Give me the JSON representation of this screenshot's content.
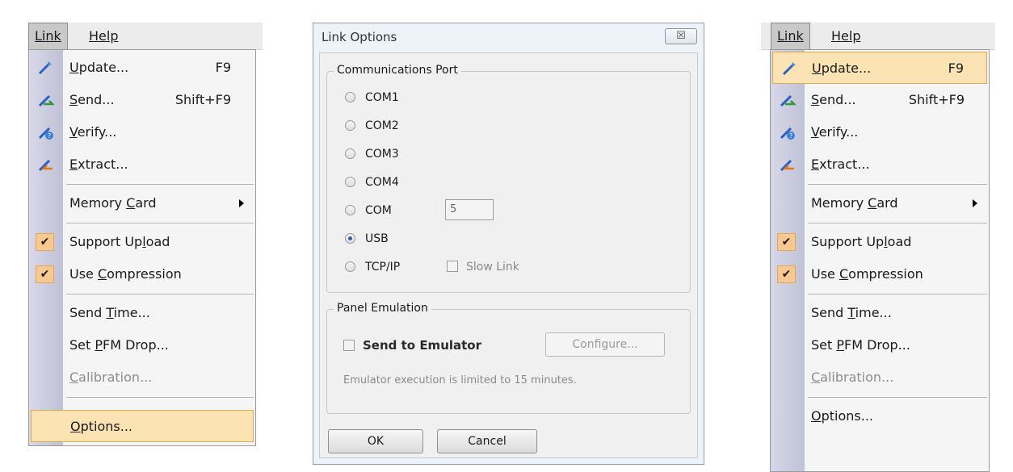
{
  "left_menu": {
    "menubar": {
      "link": "Link",
      "help": "Help"
    },
    "items": [
      {
        "label": "Update...",
        "shortcut": "F9",
        "icon": "wand-update-icon"
      },
      {
        "label": "Send...",
        "shortcut": "Shift+F9",
        "icon": "wand-send-icon"
      },
      {
        "label": "Verify...",
        "icon": "wand-verify-icon"
      },
      {
        "label": "Extract...",
        "icon": "wand-extract-icon"
      },
      {
        "label": "Memory Card"
      },
      {
        "label": "Support Upload",
        "checked": true
      },
      {
        "label": "Use Compression",
        "checked": true
      },
      {
        "label": "Send Time..."
      },
      {
        "label": "Set PFM Drop..."
      },
      {
        "label": "Calibration...",
        "disabled": true
      },
      {
        "label": "Options...",
        "highlighted": true
      }
    ]
  },
  "dialog": {
    "title": "Link Options",
    "close_glyph": "☒",
    "comm_port": {
      "legend": "Communications Port",
      "options": [
        "COM1",
        "COM2",
        "COM3",
        "COM4",
        "COM",
        "USB",
        "TCP/IP"
      ],
      "selected": "USB",
      "com_value": "5",
      "slow_link": "Slow Link"
    },
    "panel_emulation": {
      "legend": "Panel Emulation",
      "send_to_emulator": "Send to Emulator",
      "configure": "Configure...",
      "note": "Emulator execution is limited to 15 minutes."
    },
    "ok": "OK",
    "cancel": "Cancel"
  },
  "right_menu": {
    "menubar": {
      "link": "Link",
      "help": "Help"
    },
    "items": [
      {
        "label": "Update...",
        "shortcut": "F9",
        "highlighted": true
      },
      {
        "label": "Send...",
        "shortcut": "Shift+F9"
      },
      {
        "label": "Verify..."
      },
      {
        "label": "Extract..."
      },
      {
        "label": "Memory Card"
      },
      {
        "label": "Support Upload",
        "checked": true
      },
      {
        "label": "Use Compression",
        "checked": true
      },
      {
        "label": "Send Time..."
      },
      {
        "label": "Set PFM Drop..."
      },
      {
        "label": "Calibration...",
        "disabled": true
      },
      {
        "label": "Options..."
      }
    ]
  },
  "colors": {
    "highlight": "#fbe3b3",
    "highlight_border": "#e0a94d",
    "check_bg": "#f7c990",
    "radio_dot": "#2a5fb5"
  }
}
